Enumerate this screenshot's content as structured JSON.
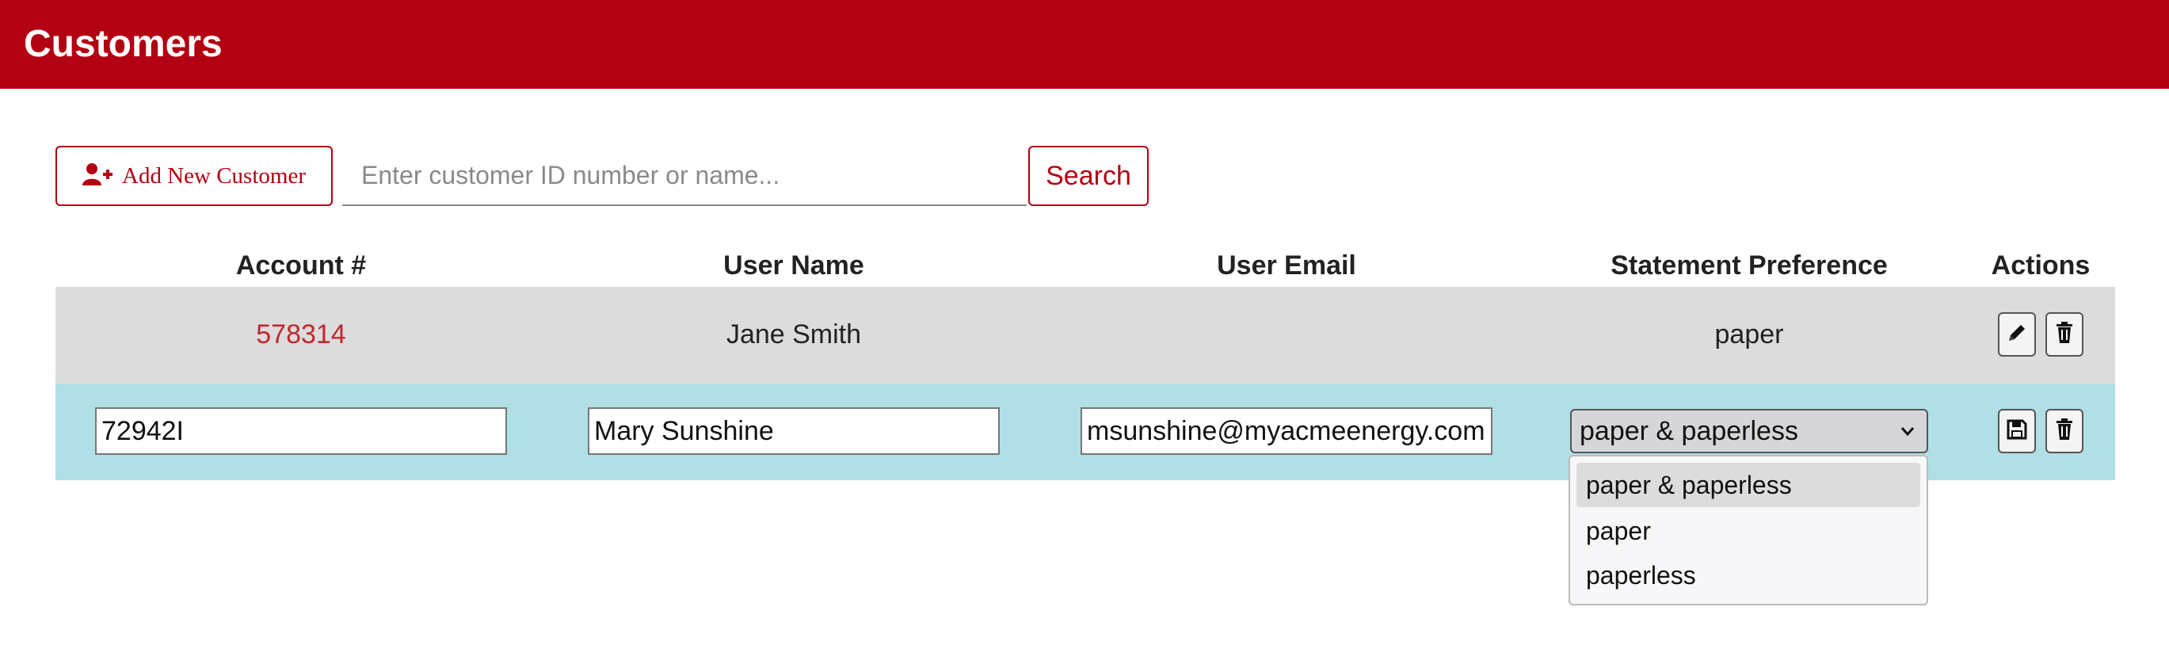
{
  "header": {
    "title": "Customers"
  },
  "toolbar": {
    "add_label": "Add New Customer",
    "search_placeholder": "Enter customer ID number or name...",
    "search_label": "Search"
  },
  "table": {
    "columns": [
      "Account #",
      "User Name",
      "User Email",
      "Statement Preference",
      "Actions"
    ],
    "rows": [
      {
        "account": "578314",
        "name": "Jane Smith",
        "email": "",
        "preference": "paper"
      }
    ],
    "editing": {
      "account": "72942I",
      "name": "Mary Sunshine",
      "email": "msunshine@myacmeenergy.com",
      "preference": "paper & paperless"
    },
    "preference_options": [
      "paper & paperless",
      "paper",
      "paperless"
    ]
  },
  "colors": {
    "brand": "#b30012",
    "row_alt": "#dcdcdc",
    "row_edit": "#b0dfe5"
  },
  "icons": [
    "add-user-icon",
    "pencil-icon",
    "trash-icon",
    "save-icon",
    "chevron-down-icon"
  ]
}
